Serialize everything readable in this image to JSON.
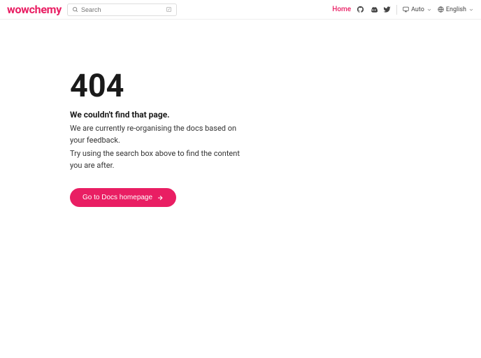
{
  "brand": "wowchemy",
  "search": {
    "placeholder": "Search"
  },
  "nav": {
    "home": "Home",
    "theme": "Auto",
    "language": "English"
  },
  "error": {
    "code": "404",
    "title": "We couldn't find that page.",
    "paragraph1": "We are currently re-organising the docs based on your feedback.",
    "paragraph2": "Try using the search box above to find the content you are after."
  },
  "cta": {
    "label": "Go to Docs homepage"
  },
  "colors": {
    "accent": "#e91e63"
  }
}
